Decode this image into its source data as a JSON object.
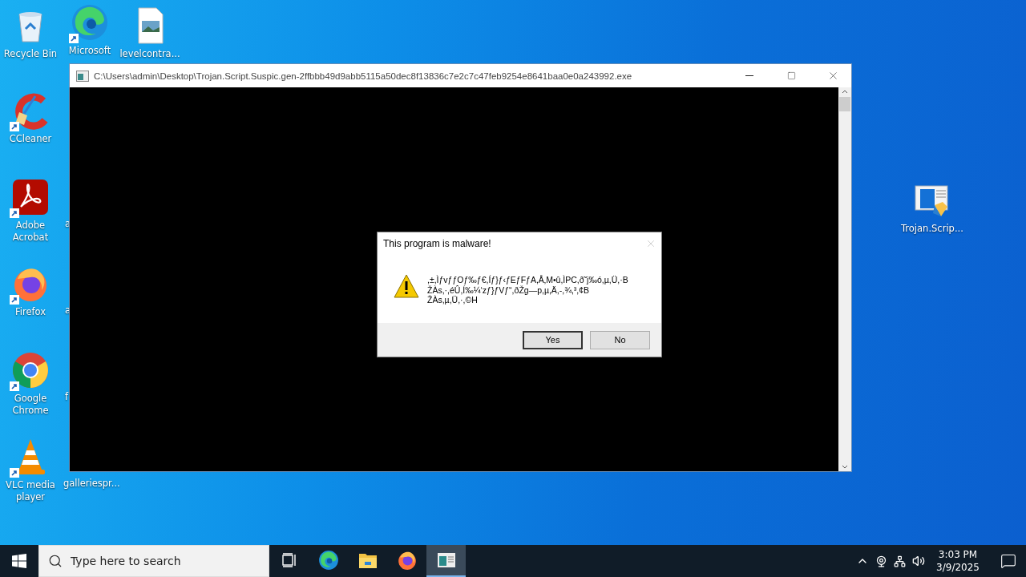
{
  "desktop_icons": [
    {
      "label": "Recycle Bin",
      "kind": "recycle-bin",
      "shortcut": false
    },
    {
      "label": "Microsoft",
      "kind": "edge",
      "shortcut": true
    },
    {
      "label": "levelcontra...",
      "kind": "image-file",
      "shortcut": false
    },
    {
      "label": "CCleaner",
      "kind": "ccleaner",
      "shortcut": true
    },
    {
      "label": "Adobe Acrobat",
      "kind": "acrobat",
      "shortcut": true
    },
    {
      "label": "a",
      "kind": "partial"
    },
    {
      "label": "Firefox",
      "kind": "firefox",
      "shortcut": true
    },
    {
      "label": "a",
      "kind": "partial"
    },
    {
      "label": "Google Chrome",
      "kind": "chrome",
      "shortcut": true
    },
    {
      "label": "f",
      "kind": "partial"
    },
    {
      "label": "VLC media player",
      "kind": "vlc",
      "shortcut": true
    },
    {
      "label": "galleriespr...",
      "kind": "partial"
    },
    {
      "label": "Trojan.Scrip...",
      "kind": "app-window",
      "shortcut": false
    }
  ],
  "window": {
    "title": "C:\\Users\\admin\\Desktop\\Trojan.Script.Suspic.gen-2ffbbb49d9abb5115a50dec8f13836c7e2c7c47feb9254e8641baa0e0a243992.exe"
  },
  "dialog": {
    "title": "This program is malware!",
    "message": ",±,ÌƒvƒƒOƒ‰ƒ€,Íƒ}ƒ‹ƒEƒFƒA,Å‚M•û,ÌPC,ð˜j‰ó,µ,Ü,·B\nŽÀs,·,éÛ,Í‰¼‘zƒ}ƒVƒ“,ðŽg—p,µ,Ä,-,¾,³,¢B\nŽÀs,µ,Ü,·,©H",
    "buttons": [
      {
        "label": "Yes",
        "selected": true
      },
      {
        "label": "No",
        "selected": false
      }
    ]
  },
  "taskbar": {
    "search": {
      "placeholder": "Type here to search"
    },
    "apps": [
      {
        "kind": "task-view",
        "active": false
      },
      {
        "kind": "edge",
        "active": false
      },
      {
        "kind": "explorer",
        "active": false
      },
      {
        "kind": "firefox",
        "active": false
      },
      {
        "kind": "app-window",
        "active": true
      }
    ],
    "time": "3:03 PM",
    "date": "3/9/2025"
  }
}
